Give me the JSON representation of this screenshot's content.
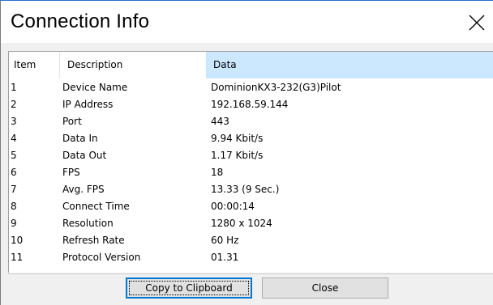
{
  "window": {
    "title": "Connection Info",
    "close_icon": "close-x"
  },
  "table": {
    "columns": {
      "item": "Item",
      "description": "Description",
      "data": "Data"
    },
    "rows": [
      {
        "item": "1",
        "description": "Device Name",
        "data": "DominionKX3-232(G3)Pilot"
      },
      {
        "item": "2",
        "description": "IP Address",
        "data": "192.168.59.144"
      },
      {
        "item": "3",
        "description": "Port",
        "data": "443"
      },
      {
        "item": "4",
        "description": "Data In",
        "data": "9.94 Kbit/s"
      },
      {
        "item": "5",
        "description": "Data Out",
        "data": "1.17 Kbit/s"
      },
      {
        "item": "6",
        "description": "FPS",
        "data": "18"
      },
      {
        "item": "7",
        "description": "Avg. FPS",
        "data": "13.33 (9 Sec.)"
      },
      {
        "item": "8",
        "description": "Connect Time",
        "data": "00:00:14"
      },
      {
        "item": "9",
        "description": "Resolution",
        "data": "1280 x 1024"
      },
      {
        "item": "10",
        "description": "Refresh Rate",
        "data": "60 Hz"
      },
      {
        "item": "11",
        "description": "Protocol Version",
        "data": "01.31"
      }
    ],
    "highlight_color": "#cce8ff"
  },
  "buttons": {
    "copy_label": "Copy to Clipboard",
    "close_label": "Close"
  }
}
